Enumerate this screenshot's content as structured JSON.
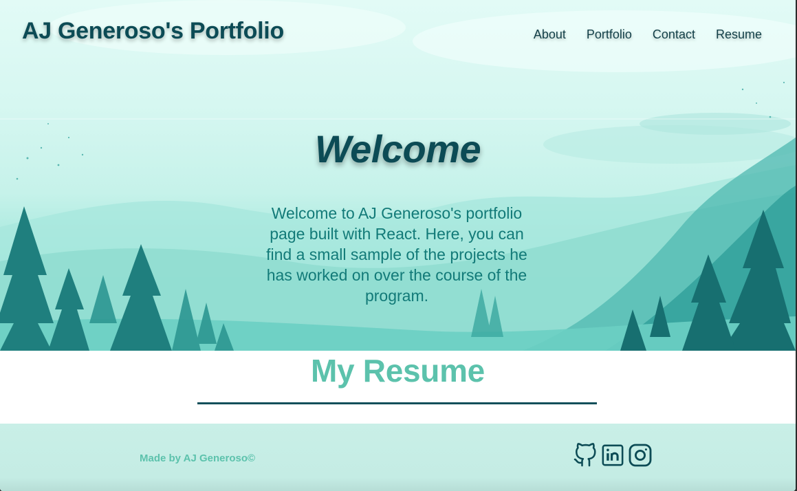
{
  "header": {
    "title": "AJ Generoso's Portfolio",
    "nav": [
      "About",
      "Portfolio",
      "Contact",
      "Resume"
    ]
  },
  "hero": {
    "heading": "Welcome",
    "text": "Welcome to AJ Generoso's portfolio page built with React. Here, you can find a small sample of the projects he has worked on over the course of the program."
  },
  "resume": {
    "heading": "My Resume"
  },
  "footer": {
    "credit": "Made by AJ Generoso©",
    "socials": [
      "github-icon",
      "linkedin-icon",
      "instagram-icon"
    ]
  },
  "colors": {
    "title": "#0c4b55",
    "accent": "#5cc2ac",
    "welcome_text": "#127a78",
    "rule": "#124f5a",
    "footer_bg": "#c9efe7"
  }
}
